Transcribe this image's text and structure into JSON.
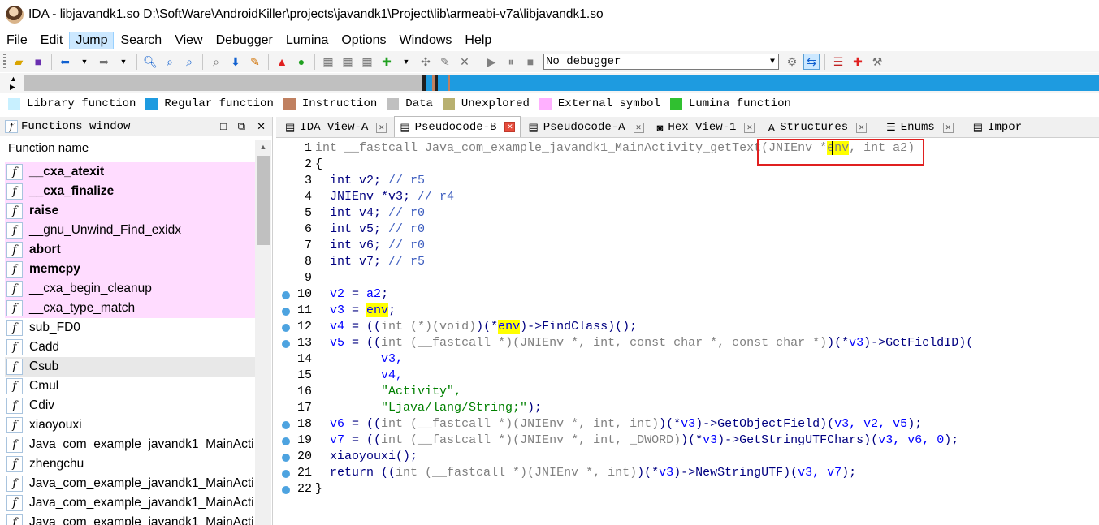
{
  "window": {
    "title": "IDA - libjavandk1.so D:\\SoftWare\\AndroidKiller\\projects\\javandk1\\Project\\lib\\armeabi-v7a\\libjavandk1.so"
  },
  "menu": [
    "File",
    "Edit",
    "Jump",
    "Search",
    "View",
    "Debugger",
    "Lumina",
    "Options",
    "Windows",
    "Help"
  ],
  "toolbar": {
    "debugger_select": "No debugger"
  },
  "legend": [
    {
      "label": "Library function",
      "color": "#c8f0ff"
    },
    {
      "label": "Regular function",
      "color": "#1e9be0"
    },
    {
      "label": "Instruction",
      "color": "#c08060"
    },
    {
      "label": "Data",
      "color": "#c0c0c0"
    },
    {
      "label": "Unexplored",
      "color": "#b8b070"
    },
    {
      "label": "External symbol",
      "color": "#ffb0ff"
    },
    {
      "label": "Lumina function",
      "color": "#30c030"
    }
  ],
  "functions_window": {
    "title": "Functions window",
    "column_header": "Function name",
    "items": [
      {
        "name": "__cxa_atexit",
        "style": "pink bold"
      },
      {
        "name": "__cxa_finalize",
        "style": "pink bold"
      },
      {
        "name": "raise",
        "style": "pink bold"
      },
      {
        "name": "__gnu_Unwind_Find_exidx",
        "style": "pink"
      },
      {
        "name": "abort",
        "style": "pink bold"
      },
      {
        "name": "memcpy",
        "style": "pink bold"
      },
      {
        "name": "__cxa_begin_cleanup",
        "style": "pink"
      },
      {
        "name": "__cxa_type_match",
        "style": "pink"
      },
      {
        "name": "sub_FD0",
        "style": ""
      },
      {
        "name": "Cadd",
        "style": ""
      },
      {
        "name": "Csub",
        "style": "sel"
      },
      {
        "name": "Cmul",
        "style": ""
      },
      {
        "name": "Cdiv",
        "style": ""
      },
      {
        "name": "xiaoyouxi",
        "style": ""
      },
      {
        "name": "Java_com_example_javandk1_MainActi",
        "style": ""
      },
      {
        "name": "zhengchu",
        "style": ""
      },
      {
        "name": "Java_com_example_javandk1_MainActi",
        "style": ""
      },
      {
        "name": "Java_com_example_javandk1_MainActi",
        "style": ""
      },
      {
        "name": "Java_com_example_javandk1_MainActi",
        "style": ""
      }
    ]
  },
  "tabs": [
    {
      "label": "IDA View-A",
      "icon": "▤",
      "close": true,
      "active": false
    },
    {
      "label": "Pseudocode-B",
      "icon": "▤",
      "close": true,
      "active": true
    },
    {
      "label": "Pseudocode-A",
      "icon": "▤",
      "close": true,
      "active": false
    },
    {
      "label": "Hex View-1",
      "icon": "◙",
      "close": true,
      "active": false
    },
    {
      "label": "Structures",
      "icon": "A",
      "close": true,
      "active": false
    },
    {
      "label": "Enums",
      "icon": "☰",
      "close": true,
      "active": false
    },
    {
      "label": "Impor",
      "icon": "▤",
      "close": false,
      "active": false
    }
  ],
  "code": {
    "lines": [
      {
        "n": "1",
        "dot": false
      },
      {
        "n": "2",
        "dot": false
      },
      {
        "n": "3",
        "dot": false
      },
      {
        "n": "4",
        "dot": false
      },
      {
        "n": "5",
        "dot": false
      },
      {
        "n": "6",
        "dot": false
      },
      {
        "n": "7",
        "dot": false
      },
      {
        "n": "8",
        "dot": false
      },
      {
        "n": "9",
        "dot": false
      },
      {
        "n": "10",
        "dot": true
      },
      {
        "n": "11",
        "dot": true
      },
      {
        "n": "12",
        "dot": true
      },
      {
        "n": "13",
        "dot": true
      },
      {
        "n": "14",
        "dot": false
      },
      {
        "n": "15",
        "dot": false
      },
      {
        "n": "16",
        "dot": false
      },
      {
        "n": "17",
        "dot": false
      },
      {
        "n": "18",
        "dot": true
      },
      {
        "n": "19",
        "dot": true
      },
      {
        "n": "20",
        "dot": true
      },
      {
        "n": "21",
        "dot": true
      },
      {
        "n": "22",
        "dot": true
      }
    ],
    "tokens": {
      "l1_a": "int __fastcall Java_com_example_javandk1_MainActivity_getText(JNIEnv *",
      "l1_env": "env",
      "l1_b": ", int a2)",
      "l2": "{",
      "l3_a": "  int v2; ",
      "l3_c": "// r5",
      "l4_a": "  JNIEnv *v3; ",
      "l4_c": "// r4",
      "l5_a": "  int v4; ",
      "l5_c": "// r0",
      "l6_a": "  int v5; ",
      "l6_c": "// r0",
      "l7_a": "  int v6; ",
      "l7_c": "// r0",
      "l8_a": "  int v7; ",
      "l8_c": "// r5",
      "l10_v": "v2",
      "l10_b": " = ",
      "l10_a2": "a2",
      "l10_e": ";",
      "l11_v": "v3",
      "l11_b": " = ",
      "l11_env": "env",
      "l11_e": ";",
      "l12_v": "v4",
      "l12_b": " = ((",
      "l12_g": "int (*)(void)",
      "l12_c": ")(*",
      "l12_env": "env",
      "l12_d": ")->FindClass)();",
      "l13_v": "v5",
      "l13_b": " = ((",
      "l13_g": "int (__fastcall *)(JNIEnv *, int, const char *, const char *)",
      "l13_c": ")(*",
      "l13_v3": "v3",
      "l13_d": ")->GetFieldID)(",
      "l14": "v3,",
      "l15": "v4,",
      "l16": "\"Activity\",",
      "l17_s": "\"Ljava/lang/String;\"",
      "l17_e": ");",
      "l18_v": "v6",
      "l18_b": " = ((",
      "l18_g": "int (__fastcall *)(JNIEnv *, int, int)",
      "l18_c": ")(*",
      "l18_v3": "v3",
      "l18_d": ")->GetObjectField)(",
      "l18_args": "v3, v2, v5",
      "l18_e": ");",
      "l19_v": "v7",
      "l19_b": " = ((",
      "l19_g": "int (__fastcall *)(JNIEnv *, int, _DWORD)",
      "l19_c": ")(*",
      "l19_v3": "v3",
      "l19_d": ")->GetStringUTFChars)(",
      "l19_args": "v3, v6, 0",
      "l19_e": ");",
      "l20": "xiaoyouxi();",
      "l21_a": "return ((",
      "l21_g": "int (__fastcall *)(JNIEnv *, int)",
      "l21_c": ")(*",
      "l21_v3": "v3",
      "l21_d": ")->NewStringUTF)(",
      "l21_args": "v3, v7",
      "l21_e": ");",
      "l22": "}"
    }
  }
}
